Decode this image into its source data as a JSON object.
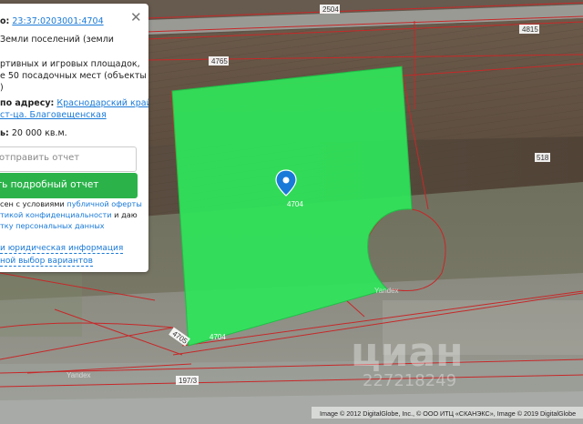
{
  "map": {
    "parcel_label": "4704",
    "parcel_label_2": "4704",
    "road_labels": [
      "2504",
      "4765",
      "4815",
      "518",
      "4705",
      "197/3"
    ],
    "watermark_left": "Yandex",
    "watermark_right": "Yandex",
    "attribution": "Image © 2012 DigitalGlobe, Inc., © ООО ИТЦ «СКАНЭКС», Image © 2019 DigitalGlobe",
    "cian_watermark": "циан",
    "cian_number": "227218249"
  },
  "panel": {
    "cadastre_prefix": "о:",
    "cadastre_number": "23:37:0203001:4704",
    "category": "Земли поселений (земли",
    "usage_line1": "ртивных и игровых площадок,",
    "usage_line2": "е 50 посадочных мест (объекты не",
    "usage_line3": ")",
    "address_prefix": "по адресу:",
    "address_line1": "Краснодарский край, р-",
    "address_line2": "ст-ца. Благовещенская",
    "area_prefix": "ь:",
    "area_value": "20 000 кв.м.",
    "send_report_placeholder": "отправить отчет",
    "detailed_report_button": "ть подробный отчет",
    "consent_line1_prefix": "сен с условиями ",
    "consent_line1_link": "публичной оферты",
    "consent_line2_link": "тикой конфиденциальности",
    "consent_line2_suffix": " и даю",
    "consent_line3_link": "тку персональных данных",
    "link_legal": "и юридическая информация",
    "link_options": "ной выбор вариантов"
  },
  "colors": {
    "parcel_fill": "#2ee65a",
    "boundary": "#c62828",
    "button": "#2bb34a",
    "link": "#1a7ad8"
  }
}
